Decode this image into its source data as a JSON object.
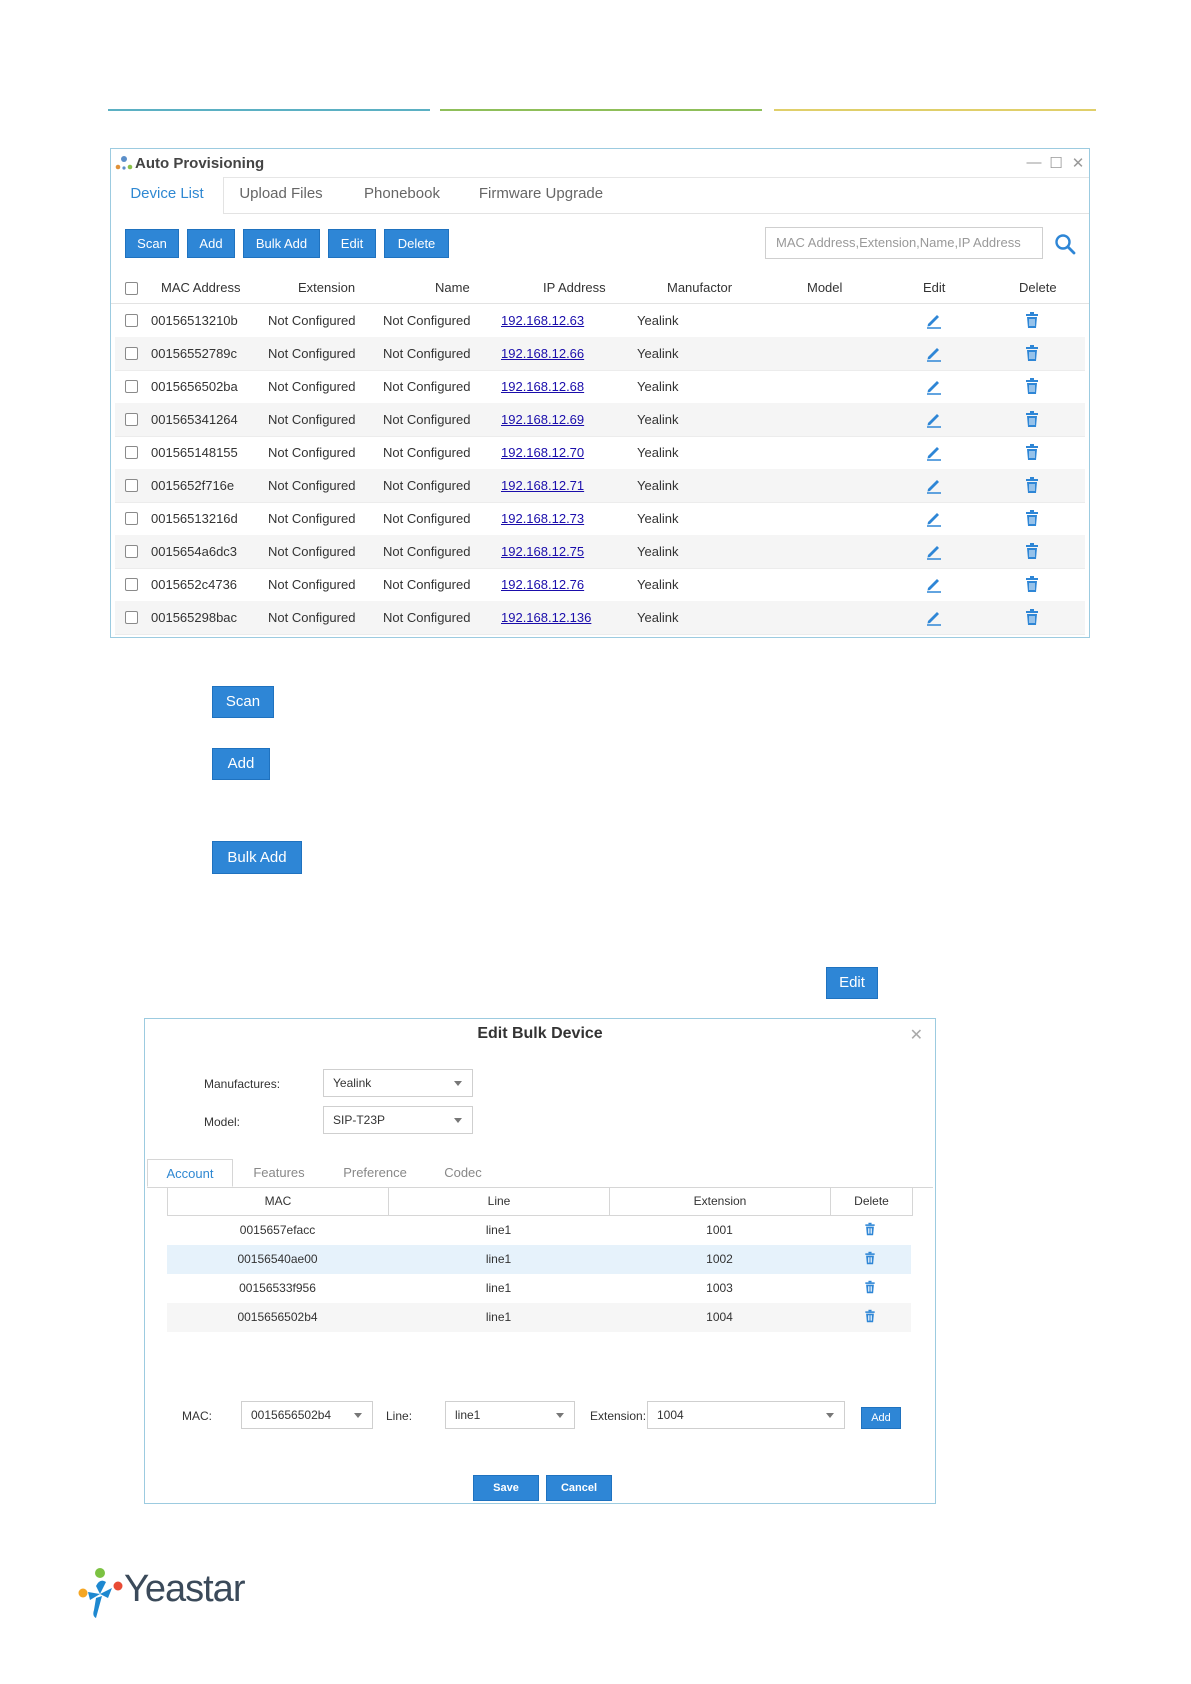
{
  "header_lines": {
    "colors": [
      "#5bb0c3",
      "#8fbf5a",
      "#e0cf6a"
    ]
  },
  "window": {
    "title": "Auto Provisioning",
    "tabs": [
      "Device List",
      "Upload Files",
      "Phonebook",
      "Firmware Upgrade"
    ],
    "toolbar": {
      "scan": "Scan",
      "add": "Add",
      "bulk_add": "Bulk Add",
      "edit": "Edit",
      "delete": "Delete"
    },
    "search_placeholder": "MAC Address,Extension,Name,IP Address",
    "columns": [
      "MAC Address",
      "Extension",
      "Name",
      "IP Address",
      "Manufactor",
      "Model",
      "Edit",
      "Delete"
    ],
    "rows": [
      {
        "mac": "00156513210b",
        "ext": "Not Configured",
        "name": "Not Configured",
        "ip": "192.168.12.63",
        "manu": "Yealink",
        "model": ""
      },
      {
        "mac": "00156552789c",
        "ext": "Not Configured",
        "name": "Not Configured",
        "ip": "192.168.12.66",
        "manu": "Yealink",
        "model": ""
      },
      {
        "mac": "0015656502ba",
        "ext": "Not Configured",
        "name": "Not Configured",
        "ip": "192.168.12.68",
        "manu": "Yealink",
        "model": ""
      },
      {
        "mac": "001565341264",
        "ext": "Not Configured",
        "name": "Not Configured",
        "ip": "192.168.12.69",
        "manu": "Yealink",
        "model": ""
      },
      {
        "mac": "001565148155",
        "ext": "Not Configured",
        "name": "Not Configured",
        "ip": "192.168.12.70",
        "manu": "Yealink",
        "model": ""
      },
      {
        "mac": "0015652f716e",
        "ext": "Not Configured",
        "name": "Not Configured",
        "ip": "192.168.12.71",
        "manu": "Yealink",
        "model": ""
      },
      {
        "mac": "00156513216d",
        "ext": "Not Configured",
        "name": "Not Configured",
        "ip": "192.168.12.73",
        "manu": "Yealink",
        "model": ""
      },
      {
        "mac": "0015654a6dc3",
        "ext": "Not Configured",
        "name": "Not Configured",
        "ip": "192.168.12.75",
        "manu": "Yealink",
        "model": ""
      },
      {
        "mac": "0015652c4736",
        "ext": "Not Configured",
        "name": "Not Configured",
        "ip": "192.168.12.76",
        "manu": "Yealink",
        "model": ""
      },
      {
        "mac": "001565298bac",
        "ext": "Not Configured",
        "name": "Not Configured",
        "ip": "192.168.12.136",
        "manu": "Yealink",
        "model": ""
      }
    ]
  },
  "standalone_buttons": {
    "scan": "Scan",
    "add": "Add",
    "bulk_add": "Bulk Add",
    "edit": "Edit"
  },
  "dialog": {
    "title": "Edit Bulk Device",
    "manufactures_label": "Manufactures:",
    "manufactures_value": "Yealink",
    "model_label": "Model:",
    "model_value": "SIP-T23P",
    "tabs": [
      "Account",
      "Features",
      "Preference",
      "Codec"
    ],
    "columns": [
      "MAC",
      "Line",
      "Extension",
      "Delete"
    ],
    "rows": [
      {
        "mac": "0015657efacc",
        "line": "line1",
        "ext": "1001"
      },
      {
        "mac": "00156540ae00",
        "line": "line1",
        "ext": "1002"
      },
      {
        "mac": "00156533f956",
        "line": "line1",
        "ext": "1003"
      },
      {
        "mac": "0015656502b4",
        "line": "line1",
        "ext": "1004"
      }
    ],
    "mac_label": "MAC:",
    "mac_value": "0015656502b4",
    "line_label": "Line:",
    "line_value": "line1",
    "extension_label": "Extension:",
    "extension_value": "1004",
    "add_label": "Add",
    "save_label": "Save",
    "cancel_label": "Cancel"
  },
  "logo": {
    "text": "Yeastar",
    "colors": [
      "#1e88d0",
      "#7cc242",
      "#f5a623",
      "#e94b35"
    ]
  },
  "colors": {
    "accent": "#2e86d6",
    "link": "#1a0dab"
  }
}
